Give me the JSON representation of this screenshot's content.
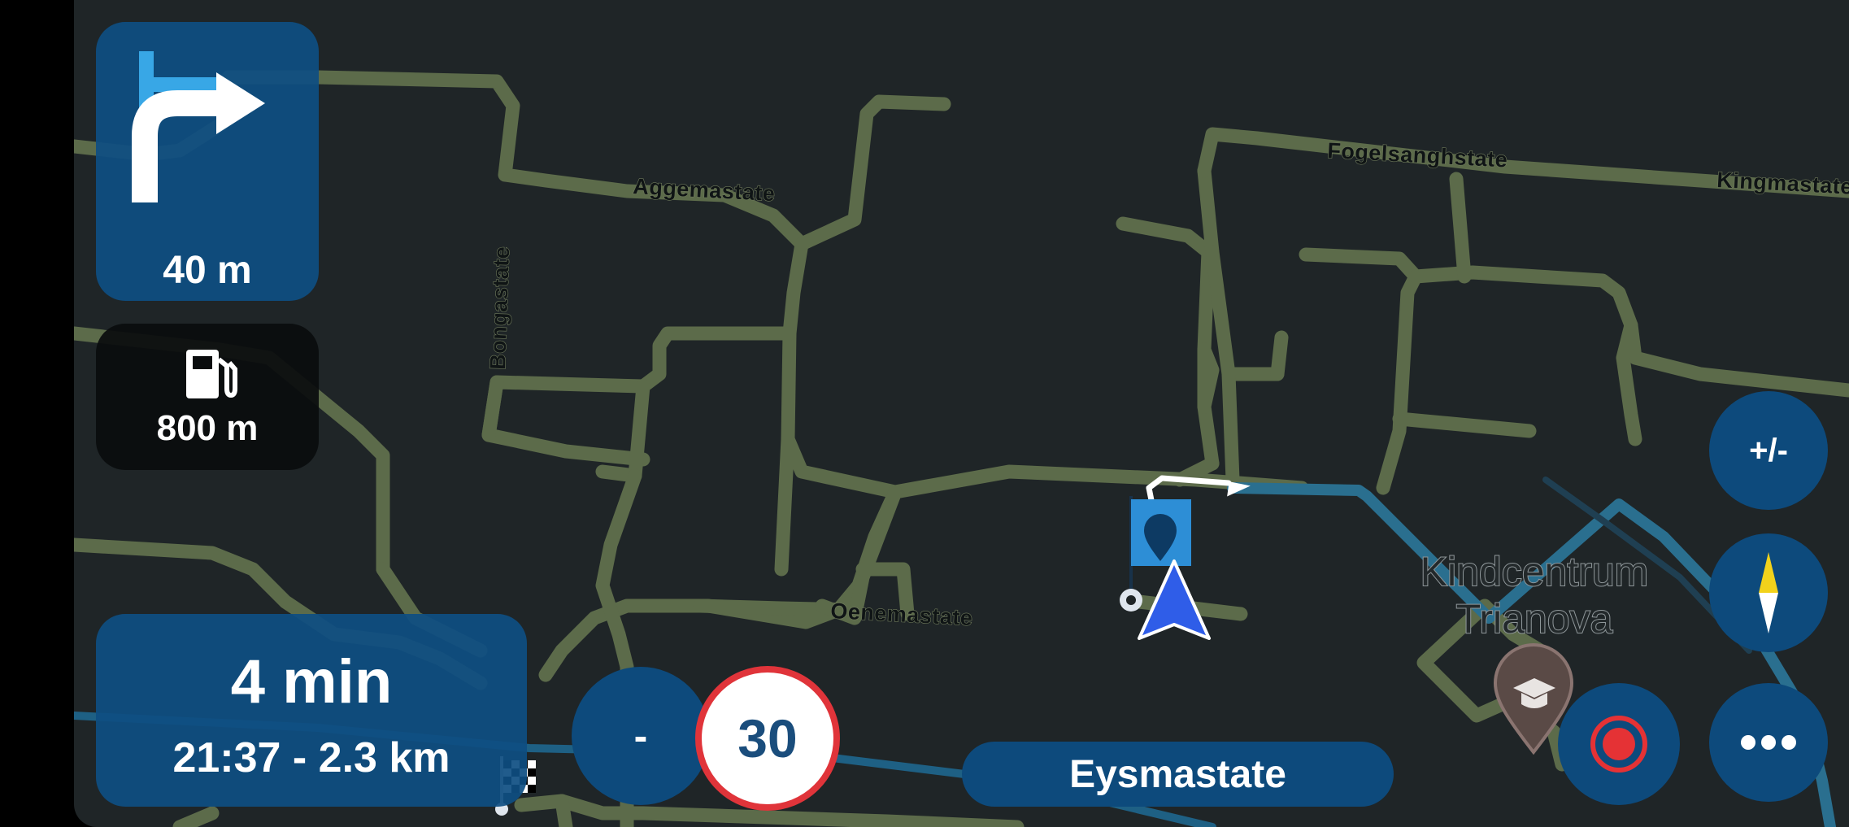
{
  "navigation": {
    "next_turn": {
      "direction": "right",
      "distance": "40 m"
    },
    "fuel": {
      "icon": "fuel-pump-icon",
      "distance": "800 m"
    },
    "eta": {
      "duration": "4 min",
      "detail": "21:37 - 2.3 km"
    },
    "speed_limit": "30",
    "current_street": "Eysmastate"
  },
  "controls": {
    "zoom_out_label": "-",
    "zoom_toggle_label": "+/-",
    "compass_icon": "compass-icon",
    "record_icon": "record-icon",
    "more_icon": "more-dots-icon"
  },
  "map": {
    "streets": [
      "Aggemastate",
      "Bongastate",
      "Fogelsanghstate",
      "Kingmastate",
      "Oenemastate"
    ],
    "poi": {
      "name_line1": "Kindcentrum",
      "name_line2": "Trianova",
      "icon": "school-icon"
    },
    "colors": {
      "background": "#1f2527",
      "road": "#5c6b4a",
      "route": "#2a6f8f",
      "route_active": "#ffffff",
      "vehicle": "#2f5de8"
    }
  }
}
